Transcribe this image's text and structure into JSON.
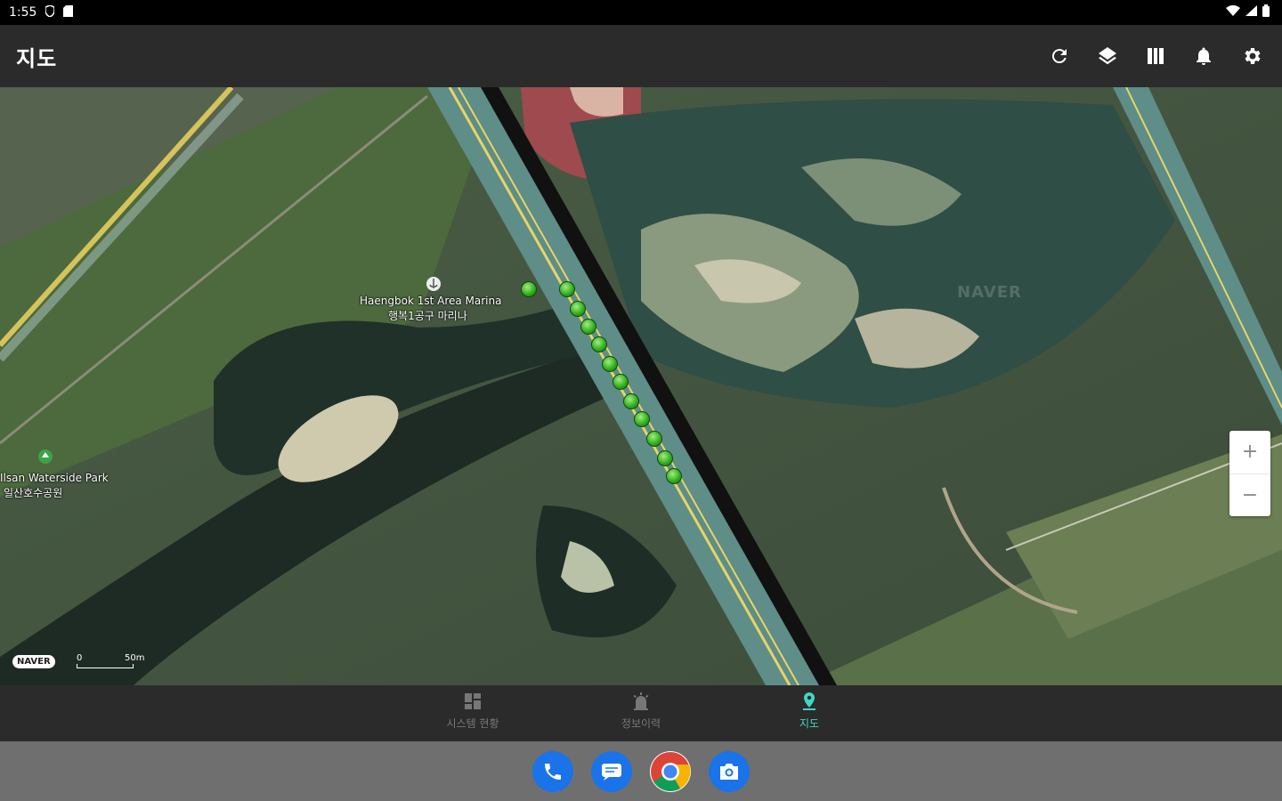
{
  "status_bar": {
    "time": "1:55"
  },
  "app_bar": {
    "title": "지도",
    "actions": [
      {
        "icon": "refresh-icon"
      },
      {
        "icon": "layers-icon"
      },
      {
        "icon": "map-icon"
      },
      {
        "icon": "bell-icon"
      },
      {
        "icon": "gear-icon"
      }
    ]
  },
  "map": {
    "poi_marina_en": "Haengbok 1st Area Marina",
    "poi_marina_ko": "행복1공구 마리나",
    "poi_park_en": "Ilsan Waterside Park",
    "poi_park_ko": "일산호수공원",
    "watermark": "NAVER",
    "logo": "NAVER",
    "scale_zero": "0",
    "scale_distance": "50m",
    "zoom_in": "+",
    "zoom_out": "−"
  },
  "bottom_nav": {
    "items": [
      {
        "label": "시스템 현황",
        "icon": "dashboard-icon",
        "active": false
      },
      {
        "label": "정보이력",
        "icon": "alarm-icon",
        "active": false
      },
      {
        "label": "지도",
        "icon": "location-pin-icon",
        "active": true
      }
    ],
    "active_color": "#3fd7c1",
    "inactive_color": "#777777"
  },
  "dock": {
    "apps": [
      {
        "name": "phone",
        "color": "#1a73e8"
      },
      {
        "name": "messages",
        "color": "#1a73e8"
      },
      {
        "name": "chrome",
        "color": "#ffffff"
      },
      {
        "name": "camera",
        "color": "#1a73e8"
      }
    ]
  }
}
